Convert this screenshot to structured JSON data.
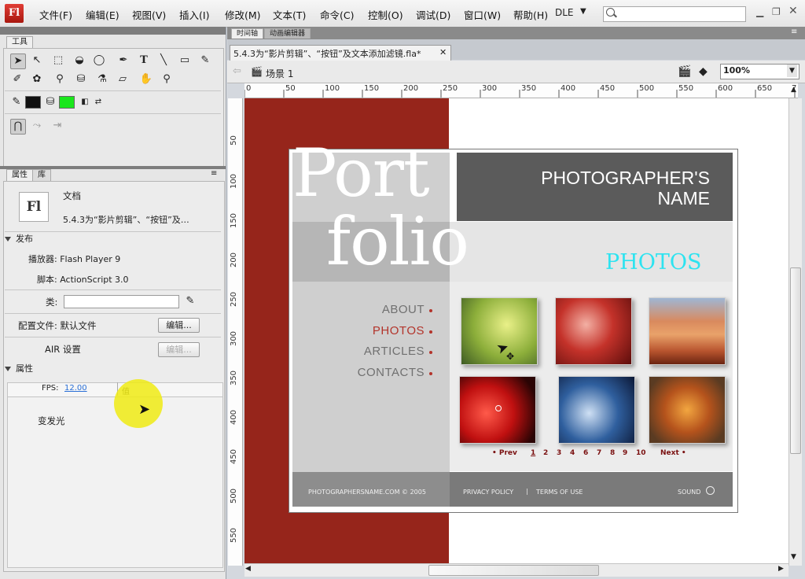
{
  "app": {
    "logo": "Fl",
    "workspace": "DLE"
  },
  "menu": [
    "文件(F)",
    "编辑(E)",
    "视图(V)",
    "插入(I)",
    "修改(M)",
    "文本(T)",
    "命令(C)",
    "控制(O)",
    "调试(D)",
    "窗口(W)",
    "帮助(H)"
  ],
  "tools_panel": {
    "tab": "工具"
  },
  "properties_panel": {
    "tabs": [
      "属性",
      "库"
    ],
    "doc_type": "文档",
    "doc_name": "5.4.3为“影片剪辑”、“按钮”及…",
    "doc_icon": "Fl",
    "publish_header": "发布",
    "player_label": "播放器: Flash Player 9",
    "script_label": "脚本: ActionScript 3.0",
    "class_label": "类:",
    "class_value": "",
    "profile_label": "配置文件: 默认文件",
    "edit_button": "编辑...",
    "air_label": "AIR 设置",
    "air_edit_button": "编辑...",
    "props_header": "属性",
    "fps_label": "FPS:",
    "fps_value": "12.00",
    "value_header": "值",
    "filter_item": "变发光"
  },
  "timeline_tabs": [
    "时间轴",
    "动画编辑器"
  ],
  "document_tab": "5.4.3为“影片剪辑”、“按钮”及文本添加滤镜.fla*",
  "scene_label": "场景 1",
  "zoom_value": "100%",
  "ruler_h": [
    "0",
    "50",
    "100",
    "150",
    "200",
    "250",
    "300",
    "350",
    "400",
    "450",
    "500",
    "550",
    "600",
    "650",
    "7"
  ],
  "ruler_v": [
    "50",
    "100",
    "150",
    "200",
    "250",
    "300",
    "350",
    "400",
    "450",
    "500",
    "550"
  ],
  "site": {
    "title_line1": "Port",
    "title_line2": "folio",
    "photographer_line1": "PHOTOGRAPHER'S",
    "photographer_line2": "NAME",
    "section_title": "PHOTOS",
    "nav": [
      "ABOUT",
      "PHOTOS",
      "ARTICLES",
      "CONTACTS"
    ],
    "pagination": {
      "prev": "• Prev",
      "pages": [
        "1",
        "2",
        "3",
        "4",
        "6",
        "7",
        "8",
        "9",
        "10"
      ],
      "next": "Next •"
    },
    "footer_domain": "PHOTOGRAPHERSNAME.COM © 2005",
    "footer_privacy": "PRIVACY POLICY",
    "footer_sep": "|",
    "footer_terms": "TERMS OF USE",
    "footer_sound": "SOUND"
  },
  "colors": {
    "stage_red": "#96251b",
    "photos_cyan": "#2de3f0",
    "nav_active": "#b3342b"
  }
}
